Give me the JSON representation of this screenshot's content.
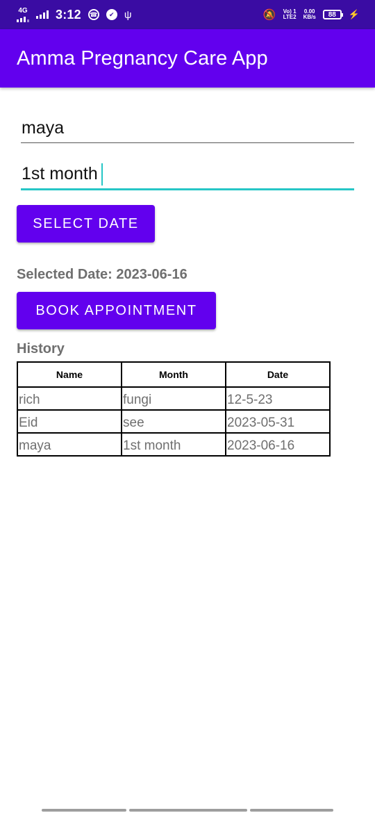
{
  "status_bar": {
    "network_type": "4G",
    "time": "3:12",
    "volte": "Vo) 1",
    "lte": "LTE2",
    "speed_value": "0.00",
    "speed_unit": "KB/s",
    "battery": "88",
    "icons": [
      "whatsapp-icon",
      "check-circle-icon",
      "usb-icon",
      "mute-notifications-icon",
      "charging-bolt-icon"
    ]
  },
  "app_bar": {
    "title": "Amma Pregnancy Care App"
  },
  "form": {
    "name_value": "maya",
    "month_value": "1st month",
    "select_date_label": "SELECT DATE",
    "selected_date_text": "Selected Date: 2023-06-16",
    "book_label": "BOOK APPOINTMENT"
  },
  "history": {
    "label": "History",
    "columns": [
      "Name",
      "Month",
      "Date"
    ],
    "rows": [
      [
        "rich",
        "fungi",
        "12-5-23"
      ],
      [
        "Eid",
        "see",
        "2023-05-31"
      ],
      [
        "maya",
        "1st month",
        "2023-06-16"
      ]
    ]
  },
  "colors": {
    "status_bar": "#3a0ca3",
    "primary": "#6200ee",
    "accent": "#26c6c6",
    "muted_text": "#6f6f6f"
  }
}
